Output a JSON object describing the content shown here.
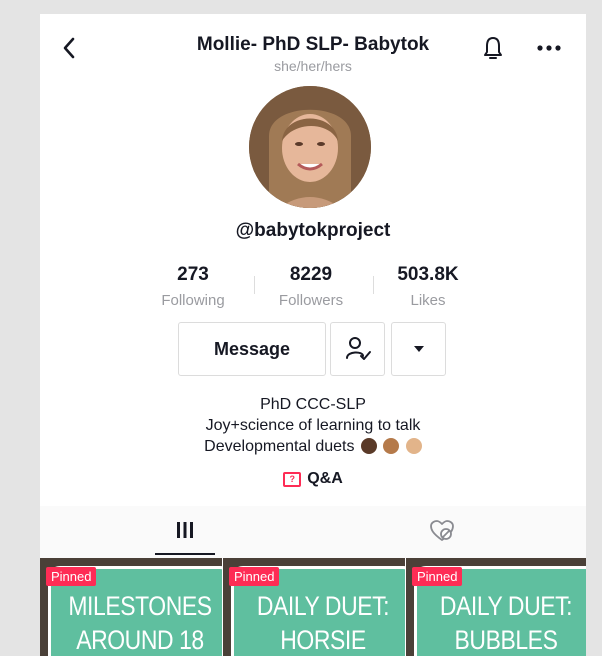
{
  "header": {
    "title": "Mollie- PhD SLP- Babytok",
    "pronouns": "she/her/hers"
  },
  "profile": {
    "username": "@babytokproject",
    "stats": [
      {
        "value": "273",
        "label": "Following"
      },
      {
        "value": "8229",
        "label": "Followers"
      },
      {
        "value": "503.8K",
        "label": "Likes"
      }
    ],
    "message_button": "Message",
    "bio_lines": [
      "PhD CCC-SLP",
      "Joy+science of learning to talk",
      "Developmental duets"
    ],
    "qa_label": "Q&A"
  },
  "icons": {
    "back": "chevron-left-icon",
    "bell": "bell-icon",
    "more": "more-dots-icon",
    "follow": "user-check-icon",
    "dropdown": "caret-down-icon",
    "grid": "grid-icon",
    "liked": "heart-hidden-icon"
  },
  "colors": {
    "accent": "#fe2c55",
    "card": "#5fbf9f"
  },
  "videos": [
    {
      "badge": "Pinned",
      "text": "MILESTONES AROUND 18"
    },
    {
      "badge": "Pinned",
      "text": "DAILY DUET: HORSIE"
    },
    {
      "badge": "Pinned",
      "text": "DAILY DUET: BUBBLES"
    }
  ]
}
